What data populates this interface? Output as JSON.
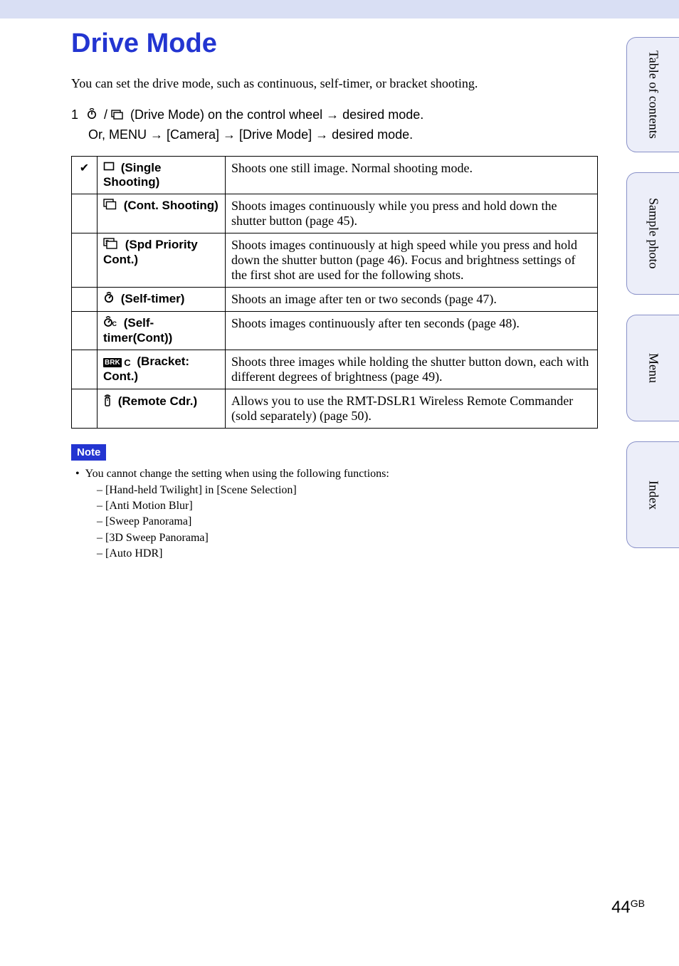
{
  "title": "Drive Mode",
  "intro": "You can set the drive mode, such as continuous, self-timer, or bracket shooting.",
  "instruction": {
    "num": "1",
    "line1_mid": " (Drive Mode) on the control wheel ",
    "line1_end": " desired mode.",
    "line2_a": "Or, MENU ",
    "line2_b": " [Camera] ",
    "line2_c": " [Drive Mode] ",
    "line2_d": " desired mode."
  },
  "arrow": "→",
  "checkmark": "✔",
  "table": [
    {
      "label": " (Single Shooting)",
      "desc": "Shoots one still image. Normal shooting mode.",
      "checked": true,
      "icon": "single"
    },
    {
      "label": " (Cont. Shooting)",
      "desc": "Shoots images continuously while you press and hold down the shutter button (page 45).",
      "checked": false,
      "icon": "cont"
    },
    {
      "label": " (Spd Priority Cont.)",
      "desc": "Shoots images continuously at high speed while you press and hold down the shutter button (page 46). Focus and brightness settings of the first shot are used for the following shots.",
      "checked": false,
      "icon": "spd"
    },
    {
      "label": " (Self-timer)",
      "desc": "Shoots an image after ten or two seconds (page 47).",
      "checked": false,
      "icon": "timer"
    },
    {
      "label": " (Self-timer(Cont))",
      "desc": "Shoots images continuously after ten seconds (page 48).",
      "checked": false,
      "icon": "timerc"
    },
    {
      "label": " (Bracket: Cont.)",
      "desc": "Shoots three images while holding the shutter button down, each with different degrees of brightness (page 49).",
      "checked": false,
      "icon": "brk"
    },
    {
      "label": " (Remote Cdr.)",
      "desc": "Allows you to use the RMT-DSLR1 Wireless Remote Commander (sold separately) (page 50).",
      "checked": false,
      "icon": "remote"
    }
  ],
  "note_label": "Note",
  "note_intro": "You cannot change the setting when using the following functions:",
  "note_items": [
    "[Hand-held Twilight] in [Scene Selection]",
    "[Anti Motion Blur]",
    "[Sweep Panorama]",
    "[3D Sweep Panorama]",
    "[Auto HDR]"
  ],
  "tabs": {
    "toc": "Table of contents",
    "sample": "Sample photo",
    "menu": "Menu",
    "index": "Index"
  },
  "page": {
    "num": "44",
    "region": "GB"
  },
  "icons": {
    "slash": " / ",
    "brk_text": "BRK",
    "brk_c": " C"
  }
}
